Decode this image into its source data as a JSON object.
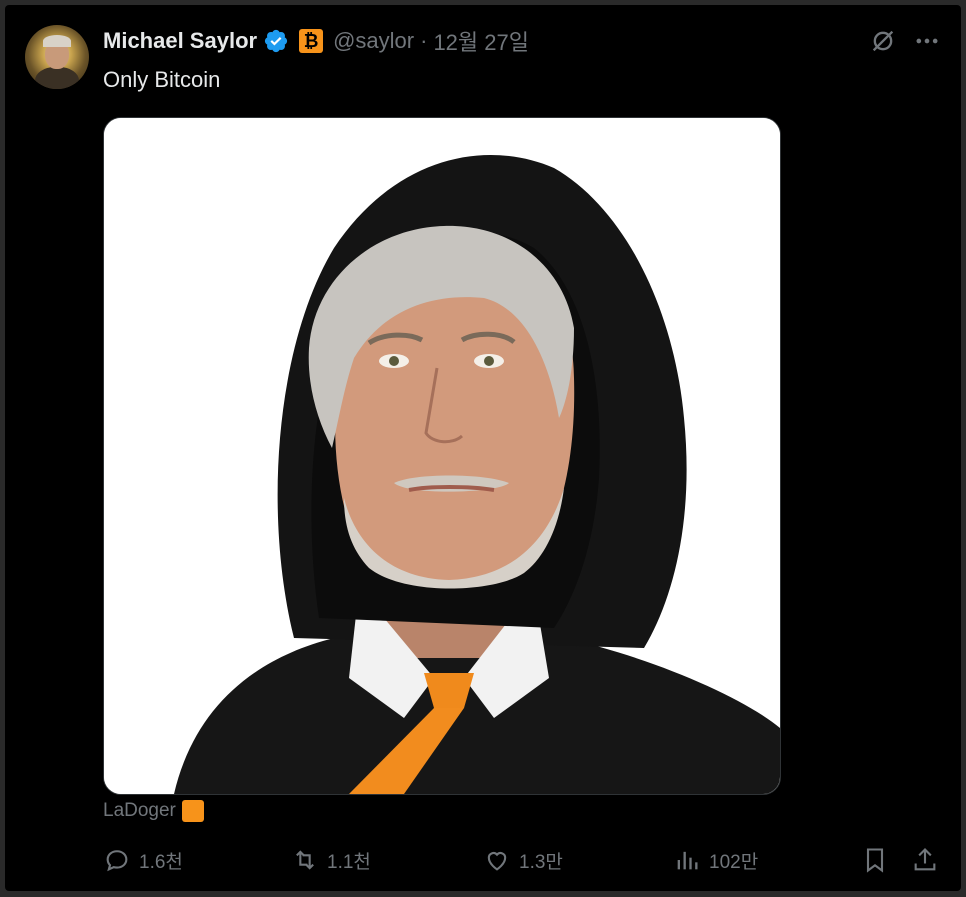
{
  "tweet": {
    "author_name": "Michael Saylor",
    "badge_text": "₿",
    "handle": "@saylor",
    "separator": "·",
    "timestamp": "12월 27일",
    "text": "Only Bitcoin",
    "media_credit": "LaDoger"
  },
  "actions": {
    "reply_count": "1.6천",
    "retweet_count": "1.1천",
    "like_count": "1.3만",
    "view_count": "102만"
  },
  "colors": {
    "background": "#000000",
    "text_primary": "#e7e9ea",
    "text_secondary": "#71767b",
    "verified_blue": "#1d9bf0",
    "bitcoin_orange": "#f7931a"
  },
  "icons": {
    "verified": "verified-badge-icon",
    "grok": "grok-icon",
    "more": "more-icon",
    "reply": "reply-icon",
    "retweet": "retweet-icon",
    "like": "like-icon",
    "views": "views-icon",
    "bookmark": "bookmark-icon",
    "share": "share-icon"
  }
}
